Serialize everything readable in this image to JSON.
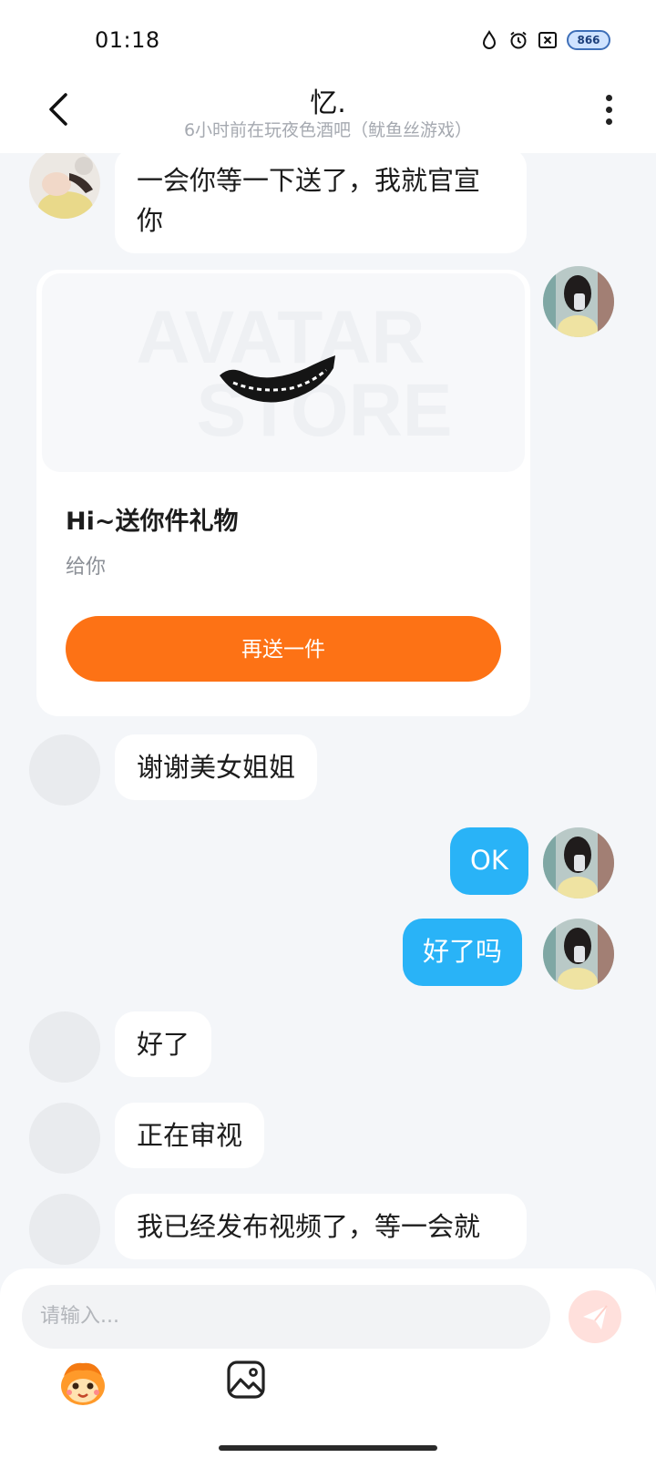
{
  "status_bar": {
    "time": "01:18",
    "icons": [
      "water-drop-icon",
      "alarm-icon",
      "close-box-icon"
    ],
    "battery_level": "66",
    "battery_display": "866"
  },
  "header": {
    "title": "忆.",
    "subtitle": "6小时前在玩夜色酒吧（鱿鱼丝游戏）",
    "back_icon": "chevron-left-icon",
    "more_icon": "more-vertical-icon"
  },
  "messages": [
    {
      "side": "in",
      "text": "一会你等一下送了，我就官宣你"
    },
    {
      "side": "out",
      "type": "gift",
      "gift": {
        "watermark": "AVATAR STORE",
        "title": "Hi~送你件礼物",
        "subtitle": "给你",
        "button": "再送一件"
      }
    },
    {
      "side": "in",
      "text": "谢谢美女姐姐"
    },
    {
      "side": "out",
      "text": "OK"
    },
    {
      "side": "out",
      "text": "好了吗"
    },
    {
      "side": "in",
      "text": "好了"
    },
    {
      "side": "in",
      "text": "正在审视"
    },
    {
      "side": "in",
      "text": "我已经发布视频了，等一会就"
    }
  ],
  "input": {
    "placeholder": "请输入...",
    "send_icon": "send-icon",
    "tools": [
      "mascot-emoji-icon",
      "image-icon"
    ]
  },
  "colors": {
    "accent_orange": "#fd7215",
    "outgoing_bubble": "#29b3f7",
    "send_button_bg": "#ffe0dc"
  }
}
